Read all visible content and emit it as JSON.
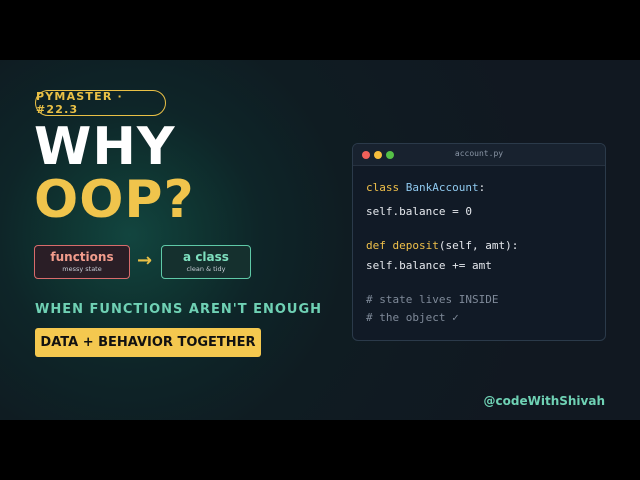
{
  "badge": "PYMASTER · #22.3",
  "title": {
    "line1": "WHY",
    "line2": "OOP?"
  },
  "diagram": {
    "from": {
      "label": "functions",
      "sublabel": "messy state"
    },
    "arrow": "→",
    "to": {
      "label": "a class",
      "sublabel": "clean & tidy"
    }
  },
  "subtitle": "WHEN FUNCTIONS AREN'T ENOUGH",
  "highlight": "DATA + BEHAVIOR TOGETHER",
  "handle": "@codeWithShivah",
  "code_window": {
    "filename": "account.py",
    "lines": {
      "l1_kw": "class",
      "l1_name": "BankAccount",
      "l1_rest": ":",
      "l2": "self.balance = 0",
      "l3_kw": "def",
      "l3_name": "deposit",
      "l3_rest": "(self, amt):",
      "l4": "self.balance += amt",
      "l5": "# state lives INSIDE",
      "l6": "# the object ✓"
    }
  },
  "colors": {
    "accent_yellow": "#f0c44c",
    "accent_teal": "#6fd1b4",
    "accent_red": "#d86b6b",
    "background": "#111821"
  }
}
